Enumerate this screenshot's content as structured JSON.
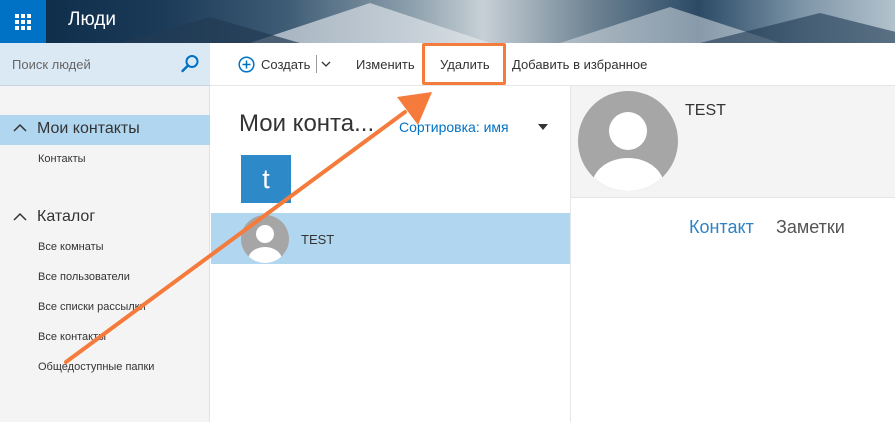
{
  "app": {
    "title": "Люди"
  },
  "search": {
    "placeholder": "Поиск людей"
  },
  "toolbar": {
    "create_label": "Создать",
    "edit_label": "Изменить",
    "delete_label": "Удалить",
    "favorite_label": "Добавить в избранное"
  },
  "nav": {
    "my_contacts": {
      "title": "Мои контакты",
      "items": [
        "Контакты"
      ]
    },
    "catalog": {
      "title": "Каталог",
      "items": [
        "Все комнаты",
        "Все пользователи",
        "Все списки рассылки",
        "Все контакты",
        "Общедоступные папки"
      ]
    }
  },
  "list": {
    "title": "Мои конта...",
    "sort_label": "Сортировка: имя",
    "letter": "t",
    "contacts": [
      {
        "name": "TEST"
      }
    ]
  },
  "detail": {
    "name": "TEST",
    "tabs": [
      "Контакт",
      "Заметки"
    ]
  },
  "colors": {
    "brand": "#0072c6",
    "selection": "#b1d6f0",
    "annotation": "#f47b3b",
    "tile": "#2d89c8"
  },
  "icons": [
    "waffle-icon",
    "search-icon",
    "plus-circle-icon",
    "chevron-down-icon",
    "chevron-up-icon",
    "caret-down-icon",
    "avatar-icon",
    "annotation-arrow"
  ]
}
